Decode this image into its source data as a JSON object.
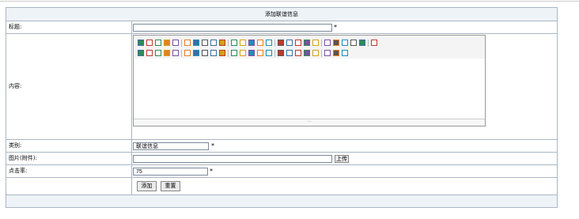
{
  "form": {
    "title": "添加联谊信息",
    "labels": {
      "title": "标题:",
      "content": "内容:",
      "category": "类别:",
      "image": "图片(附件):",
      "clicks": "点击率:"
    },
    "values": {
      "title": "",
      "category": "联谊信息",
      "image": "",
      "clicks": "75"
    },
    "required_mark": "*",
    "upload_label": "上传",
    "add_label": "添加",
    "reset_label": "重置"
  },
  "editor": {
    "toolbar_row1": [
      "source-icon",
      "undo-icon",
      "redo-icon",
      "preview-icon",
      "print-icon",
      "template-icon",
      "templates-icon",
      "cut-icon",
      "copy-icon",
      "paste-icon",
      "paste-text-icon",
      "paste-word-icon",
      "align-left-icon",
      "align-center-icon",
      "align-right-icon",
      "justify-icon",
      "ordered-list-icon",
      "unordered-list-icon",
      "indent-icon",
      "outdent-icon",
      "subscript-icon",
      "superscript-icon",
      "clear-format-icon",
      "select-all-icon",
      "cursor-icon",
      "fullscreen-icon"
    ],
    "toolbar_row2": [
      "heading-icon",
      "font-family-icon",
      "font-size-icon",
      "font-color-icon",
      "bg-color-icon",
      "bold-icon",
      "italic-icon",
      "underline-icon",
      "strikethrough-icon",
      "line-height-icon",
      "remove-format-icon",
      "image-icon",
      "flash-icon",
      "media-icon",
      "table-icon",
      "hr-icon",
      "emoticon-icon",
      "map-icon",
      "pagebreak-icon",
      "anchor-icon",
      "link-icon",
      "unlink-icon",
      "about-icon"
    ],
    "resize_handle": "···"
  },
  "colors": {
    "border": "#aab6c2",
    "header_bg": "#eef3f7"
  }
}
